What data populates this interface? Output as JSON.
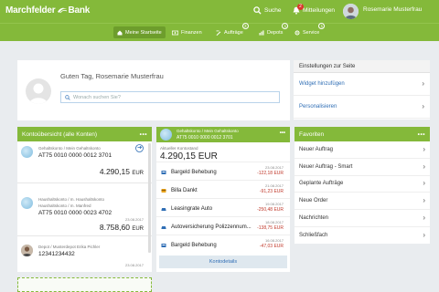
{
  "header": {
    "logo_left": "Marchfelder",
    "logo_right": "Bank",
    "search_label": "Suche",
    "messages_label": "Mitteilungen",
    "messages_count": "2",
    "user_name": "Rosemarie Musterfrau"
  },
  "nav": {
    "items": [
      {
        "label": "Meine Startseite",
        "icon": "home-icon"
      },
      {
        "label": "Finanzen",
        "icon": "money-icon"
      },
      {
        "label": "Aufträge",
        "icon": "orders-icon",
        "badge": "3"
      },
      {
        "label": "Depots",
        "icon": "depot-icon",
        "badge": "1"
      },
      {
        "label": "Service",
        "icon": "service-icon",
        "badge": "1"
      }
    ]
  },
  "welcome": {
    "greeting": "Guten Tag, Rosemarie Musterfrau",
    "search_placeholder": "Wonach suchen Sie?"
  },
  "settings": {
    "title": "Einstellungen zur Seite",
    "links": [
      "Widget hinzufügen",
      "Personalisieren"
    ]
  },
  "accounts": {
    "title": "Kontoübersicht (alle Konten)",
    "items": [
      {
        "sub": "Gehaltskonto / Mein Gehaltskonto",
        "number": "AT75 0010 0000 0012 3701",
        "date": "",
        "balance": "4.290,15",
        "currency": "EUR"
      },
      {
        "sub": "Haushaltskonto / m. Haushaltskonto",
        "sub2": "Haushaltskonto / m. Manfred",
        "number": "AT75 0010 0000 0023 4702",
        "date": "23.08.2017",
        "balance": "8.758,60",
        "currency": "EUR"
      },
      {
        "sub": "Depot / Musterdepot Erika Pichler",
        "number": "12341234432",
        "date": "23.08.2017",
        "balance": "",
        "currency": ""
      }
    ]
  },
  "detail": {
    "head_line1": "Gehaltskonto / Mein Gehaltskonto",
    "head_line2": "AT75 0010 0000 0012 3701",
    "current_label": "Aktueller Kontostand",
    "current_balance": "4.290,15 EUR",
    "transactions": [
      {
        "name": "Bargeld Behebung",
        "date": "23.08.2017",
        "amount": "-122,18 EUR",
        "icon": "atm-icon"
      },
      {
        "name": "Billa Dankt",
        "date": "21.08.2017",
        "amount": "-91,23 EUR",
        "icon": "card-icon"
      },
      {
        "name": "Leasingrate Auto",
        "date": "19.08.2017",
        "amount": "-250,48 EUR",
        "icon": "car-icon"
      },
      {
        "name": "Autoversicherung Polizzennum...",
        "date": "18.08.2017",
        "amount": "-138,75 EUR",
        "icon": "car-icon"
      },
      {
        "name": "Bargeld Behebung",
        "date": "16.08.2017",
        "amount": "-47,03 EUR",
        "icon": "atm-icon"
      }
    ],
    "button_label": "Kontodetails"
  },
  "favorites": {
    "title": "Favoriten",
    "items": [
      "Neuer Auftrag",
      "Neuer Auftrag - Smart",
      "Geplante Aufträge",
      "Neue Order",
      "Nachrichten",
      "Schließfach"
    ]
  },
  "colors": {
    "brand": "#84b93a",
    "link": "#2f6eb5",
    "negative": "#c0392b"
  }
}
